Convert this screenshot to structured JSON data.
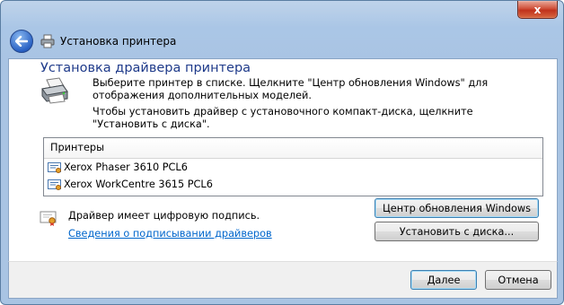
{
  "window": {
    "close_glyph": "x"
  },
  "nav": {
    "title": "Установка принтера"
  },
  "main": {
    "heading": "Установка драйвера принтера",
    "desc_line1": "Выберите принтер в списке. Щелкните \"Центр обновления Windows\" для отображения дополнительных моделей.",
    "desc_line2": "Чтобы установить драйвер с установочного компакт-диска, щелкните \"Установить с диска\"."
  },
  "printers_list": {
    "header": "Принтеры",
    "items": [
      {
        "label": "Xerox Phaser 3610 PCL6",
        "selected": false
      },
      {
        "label": "Xerox WorkCentre 3615 PCL6",
        "selected": false
      }
    ]
  },
  "signature": {
    "text": "Драйвер имеет цифровую подпись.",
    "link": "Сведения о подписывании драйверов"
  },
  "buttons": {
    "windows_update": "Центр обновления Windows",
    "have_disk": "Установить с диска...",
    "next": "Далее",
    "cancel": "Отмена"
  },
  "colors": {
    "title_blue": "#1e3a8a",
    "link_blue": "#0066cc",
    "chrome": "#a9c4e3"
  }
}
